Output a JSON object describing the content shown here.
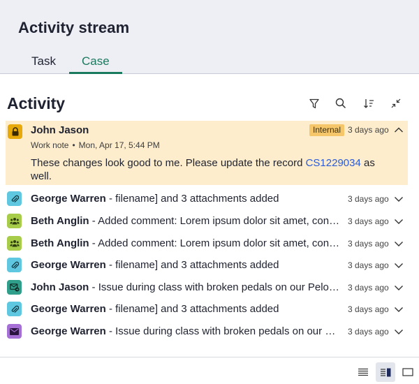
{
  "header": {
    "title": "Activity stream"
  },
  "tabs": [
    {
      "label": "Task"
    },
    {
      "label": "Case"
    }
  ],
  "activity": {
    "title": "Activity"
  },
  "toolbar_icons": [
    "filter-icon",
    "search-icon",
    "sort-icon",
    "collapse-icon"
  ],
  "expanded": {
    "author": "John Jason",
    "badge": "Internal",
    "time": "3 days ago",
    "type": "Work note",
    "date": "Mon, Apr 17, 5:44 PM",
    "message_before": "These changes look good to me. Please update the record ",
    "link": "CS1229034",
    "message_after": " as well."
  },
  "items": [
    {
      "icon": "paperclip-icon",
      "color": "#5fc8e0",
      "author": "George Warren",
      "text": " - filename] and 3 attachments added",
      "time": "3 days ago"
    },
    {
      "icon": "people-icon",
      "color": "#a6cc4a",
      "author": "Beth Anglin",
      "text": " - Added comment: Lorem ipsum dolor sit amet, consectetur",
      "time": "3 days ago"
    },
    {
      "icon": "people-icon",
      "color": "#a6cc4a",
      "author": "Beth Anglin",
      "text": " - Added comment: Lorem ipsum dolor sit amet, consectetur",
      "time": "3 days ago"
    },
    {
      "icon": "paperclip-icon",
      "color": "#5fc8e0",
      "author": "George Warren",
      "text": " - filename] and 3 attachments added",
      "time": "3 days ago"
    },
    {
      "icon": "email-send-icon",
      "color": "#2f9e8a",
      "author": "John Jason",
      "text": " - Issue during class with broken pedals on our Peloton bike",
      "time": "3 days ago"
    },
    {
      "icon": "paperclip-icon",
      "color": "#5fc8e0",
      "author": "George Warren",
      "text": " - filename] and 3 attachments added",
      "time": "3 days ago"
    },
    {
      "icon": "envelope-icon",
      "color": "#a56fd6",
      "author": "George Warren",
      "text": " - Issue during class with broken pedals on our Peloton bike",
      "time": "3 days ago"
    }
  ],
  "footer_views": [
    "list-view-icon",
    "split-view-icon",
    "single-view-icon"
  ]
}
